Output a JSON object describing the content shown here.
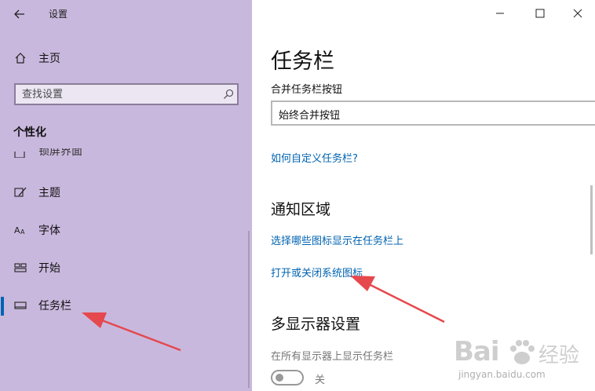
{
  "window": {
    "title": "设置"
  },
  "sidebar": {
    "home_label": "主页",
    "search_placeholder": "查找设置",
    "section_title": "个性化",
    "partial_item_label": "锁屏界面",
    "items": [
      {
        "label": "主题",
        "icon": "brush-icon"
      },
      {
        "label": "字体",
        "icon": "font-icon"
      },
      {
        "label": "开始",
        "icon": "start-icon"
      },
      {
        "label": "任务栏",
        "icon": "taskbar-icon",
        "selected": true
      }
    ]
  },
  "main": {
    "title": "任务栏",
    "combine_label": "合并任务栏按钮",
    "combine_value": "始终合并按钮",
    "customize_link": "如何自定义任务栏?",
    "notification_heading": "通知区域",
    "select_icons_link": "选择哪些图标显示在任务栏上",
    "system_icons_link": "打开或关闭系统图标",
    "multi_display_heading": "多显示器设置",
    "show_all_displays_label": "在所有显示器上显示任务栏",
    "toggle_state": "关"
  },
  "colors": {
    "sidebar_bg": "#c9b8dd",
    "accent": "#0063b1",
    "annotation_arrow": "#e5484d"
  },
  "watermark": {
    "brand": "Bai",
    "brand_suffix": "经验",
    "url": "jingyan.baidu.com"
  }
}
